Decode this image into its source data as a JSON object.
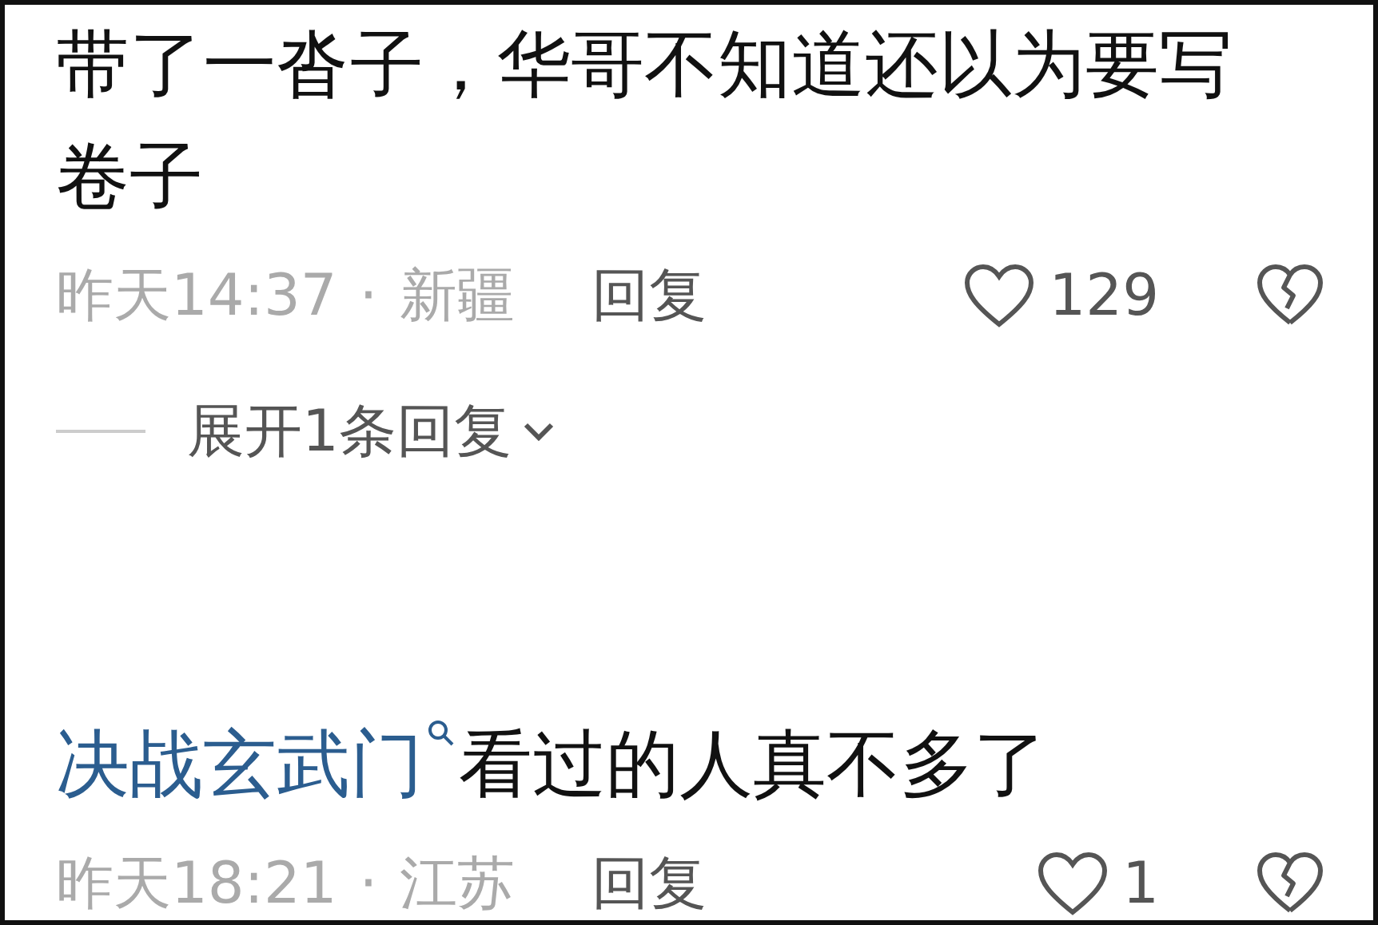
{
  "comments": [
    {
      "text": "带了一沓子，华哥不知道还以为要写卷子",
      "time": "昨天14:37",
      "separator": "·",
      "location": "新疆",
      "reply": "回复",
      "likes": "129",
      "expand": "展开1条回复"
    },
    {
      "user": "决战玄武门",
      "text": "看过的人真不多了",
      "time": "昨天18:21",
      "separator": "·",
      "location": "江苏",
      "reply": "回复",
      "likes": "1"
    }
  ]
}
